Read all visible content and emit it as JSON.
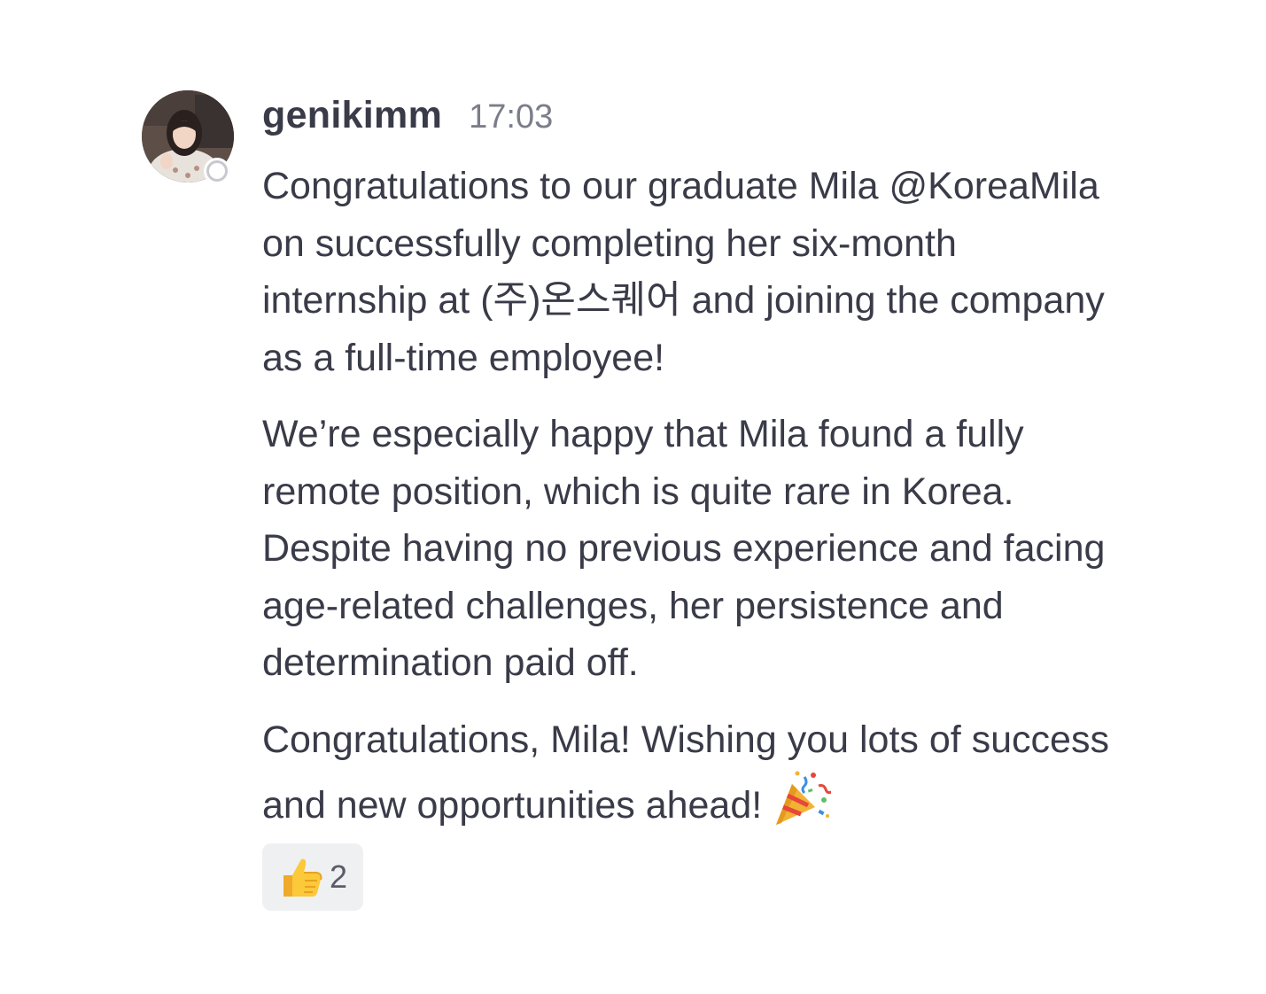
{
  "message": {
    "username": "genikimm",
    "timestamp": "17:03",
    "paragraphs": [
      "Congratulations to our graduate Mila @KoreaMila on successfully completing her six-month internship at (주)온스퀘어 and joining the company as a full-time employee!",
      "We’re especially happy that Mila found a fully remote position, which is quite rare in Korea. Despite having no previous experience and facing age-related challenges, her persistence and determination paid off.",
      "Congratulations, Mila! Wishing you lots of success and new opportunities ahead!"
    ],
    "status": "offline",
    "trailing_emoji_icon": "party-popper-icon",
    "reactions": [
      {
        "icon": "thumbs-up-icon",
        "count": "2"
      }
    ]
  },
  "colors": {
    "text": "#3a3b48",
    "timestamp": "#7b7d8a",
    "reaction_bg": "#eff0f2",
    "status_ring": "#c8c9cf"
  }
}
